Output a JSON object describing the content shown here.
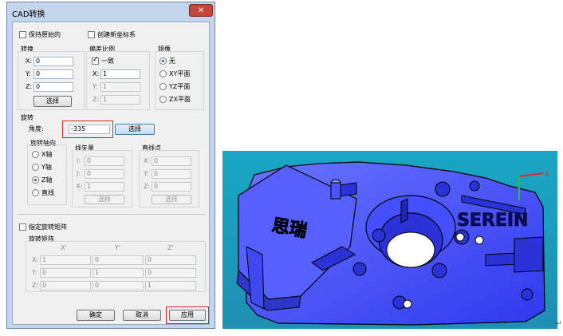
{
  "dialog": {
    "title": "CAD转换",
    "close": "✕",
    "keep_origin": "保持原始的",
    "create_coord": "创建新坐标系",
    "translate": {
      "header": "转换",
      "x_label": "X:",
      "x": "0",
      "y_label": "Y:",
      "y": "0",
      "z_label": "Z:",
      "z": "0",
      "select": "选择"
    },
    "scale": {
      "header": "偏差比例",
      "uniform": "一致",
      "x_label": "X:",
      "x": "1",
      "y_label": "Y:",
      "y": "1",
      "z_label": "Z:",
      "z": "1"
    },
    "mirror": {
      "header": "镜像",
      "none": "无",
      "xy": "XY平面",
      "yz": "YZ平面",
      "zx": "ZX平面"
    },
    "rotate": {
      "header": "旋转",
      "angle_label": "角度:",
      "angle": "-335",
      "select": "选择",
      "axis_header": "旋转轴向",
      "axis_x": "X轴",
      "axis_y": "Y轴",
      "axis_z": "Z轴",
      "axis_line": "直线",
      "vector_header": "线矢量",
      "vec_i_label": "I:",
      "vec_i": "0",
      "vec_j_label": "J:",
      "vec_j": "0",
      "vec_k_label": "K:",
      "vec_k": "1",
      "vec_select": "选择",
      "point_header": "直线点",
      "pt_x_label": "X:",
      "pt_x": "0",
      "pt_y_label": "Y:",
      "pt_y": "0",
      "pt_z_label": "Z:",
      "pt_z": "0",
      "pt_select": "选择"
    },
    "matrix": {
      "specify": "指定旋转矩阵",
      "header": "旋转矩阵",
      "col_x": "X'",
      "col_y": "Y'",
      "col_z": "Z'",
      "row_x": "X:",
      "row_y": "Y:",
      "row_z": "Z:",
      "values": [
        [
          "1",
          "0",
          "0"
        ],
        [
          "0",
          "1",
          "0"
        ],
        [
          "0",
          "0",
          "1"
        ]
      ]
    },
    "ok": "确定",
    "cancel": "取消",
    "apply": "应用"
  },
  "viewport": {
    "engraved_left": "思瑞",
    "engraved_right": "SEREIN",
    "background_color": "#1f9fbd",
    "part_color": "#3c46ff"
  }
}
